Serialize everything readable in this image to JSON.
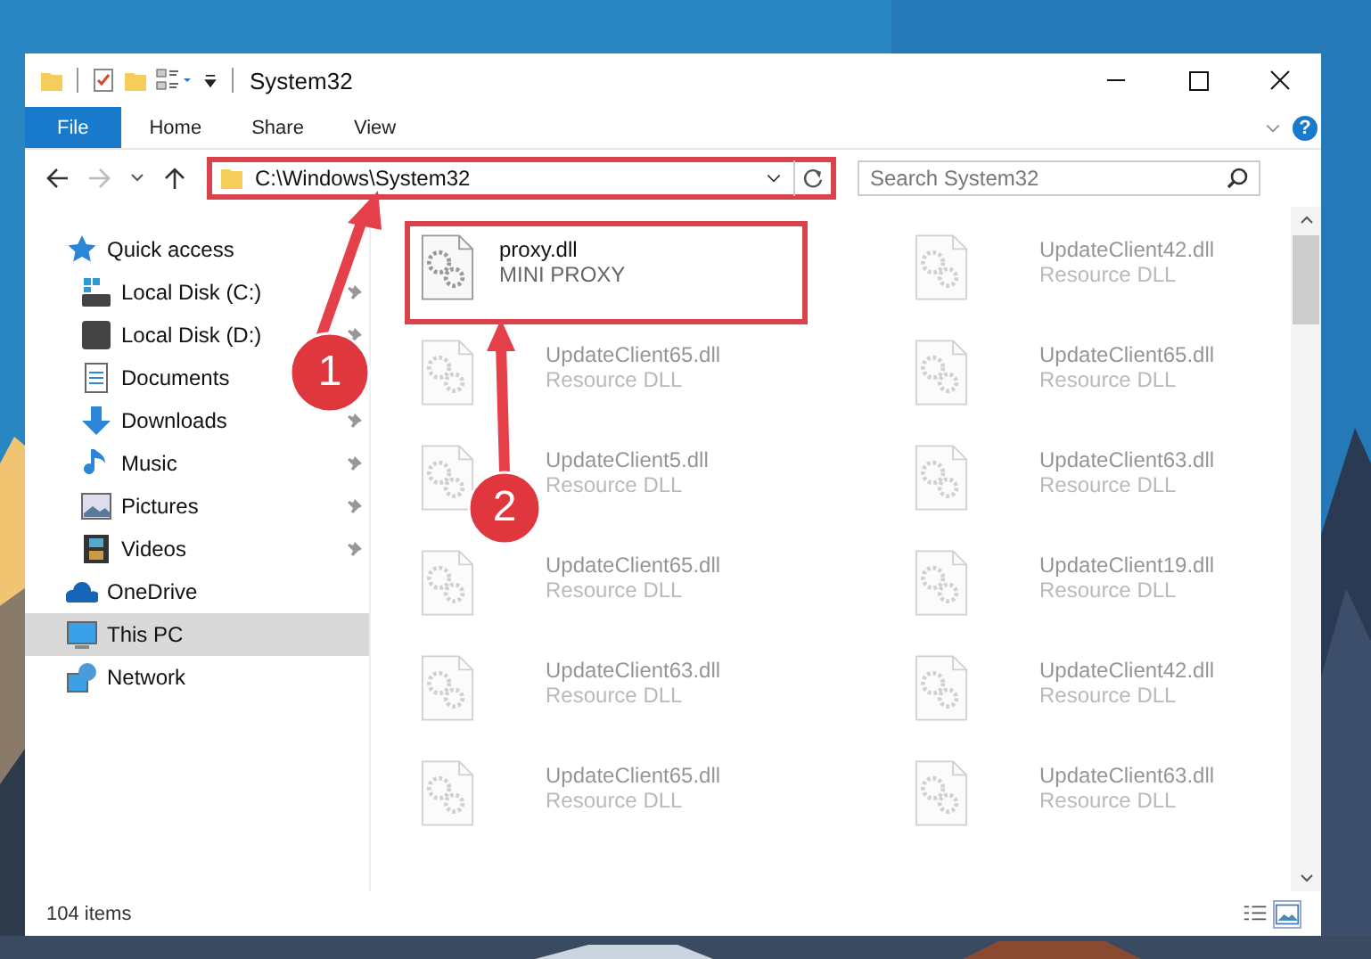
{
  "window": {
    "title": "System32"
  },
  "ribbon": {
    "tabs": [
      {
        "label": "File",
        "kind": "file"
      },
      {
        "label": "Home",
        "kind": "tab"
      },
      {
        "label": "Share",
        "kind": "tab"
      },
      {
        "label": "View",
        "kind": "tab"
      }
    ],
    "help": "?"
  },
  "address": {
    "path": "C:\\Windows\\System32",
    "highlighted": true
  },
  "search": {
    "placeholder": "Search System32"
  },
  "sidebar": {
    "items": [
      {
        "label": "Quick access",
        "kind": "star",
        "selected": false,
        "children": [
          {
            "label": "Local Disk (C:)",
            "kind": "drive-c",
            "pinned": true,
            "selected": false
          },
          {
            "label": "Local Disk (D:)",
            "kind": "drive",
            "pinned": true,
            "selected": false
          },
          {
            "label": "Documents",
            "kind": "documents",
            "selected": false
          },
          {
            "label": "Downloads",
            "kind": "downloads",
            "pinned": true,
            "selected": false
          },
          {
            "label": "Music",
            "kind": "music",
            "pinned": true,
            "selected": false
          },
          {
            "label": "Pictures",
            "kind": "pictures",
            "pinned": true,
            "selected": false
          },
          {
            "label": "Videos",
            "kind": "videos",
            "pinned": true,
            "selected": false
          }
        ]
      },
      {
        "label": "OneDrive",
        "kind": "cloud",
        "selected": false
      },
      {
        "label": "This PC",
        "kind": "pc",
        "selected": true
      },
      {
        "label": "Network",
        "kind": "network",
        "selected": false
      }
    ]
  },
  "files": [
    {
      "name": "proxy.dll",
      "type": "MINI PROXY",
      "highlighted": true,
      "blurred": false
    },
    {
      "name": "UpdateClient42.dll",
      "type": "Resource DLL",
      "blurred": true
    },
    {
      "name": "UpdateClient65.dll",
      "type": "Resource DLL",
      "blurred": true
    },
    {
      "name": "UpdateClient65.dll",
      "type": "Resource DLL",
      "blurred": true
    },
    {
      "name": "UpdateClient5.dll",
      "type": "Resource DLL",
      "blurred": true
    },
    {
      "name": "UpdateClient63.dll",
      "type": "Resource DLL",
      "blurred": true
    },
    {
      "name": "UpdateClient65.dll",
      "type": "Resource DLL",
      "blurred": true
    },
    {
      "name": "UpdateClient19.dll",
      "type": "Resource DLL",
      "blurred": true
    },
    {
      "name": "UpdateClient63.dll",
      "type": "Resource DLL",
      "blurred": true
    },
    {
      "name": "UpdateClient42.dll",
      "type": "Resource DLL",
      "blurred": true
    },
    {
      "name": "UpdateClient65.dll",
      "type": "Resource DLL",
      "blurred": true
    },
    {
      "name": "UpdateClient63.dll",
      "type": "Resource DLL",
      "blurred": true
    }
  ],
  "status_bar": {
    "count": "104 items"
  },
  "callouts": [
    {
      "number": "1"
    },
    {
      "number": "2"
    }
  ]
}
